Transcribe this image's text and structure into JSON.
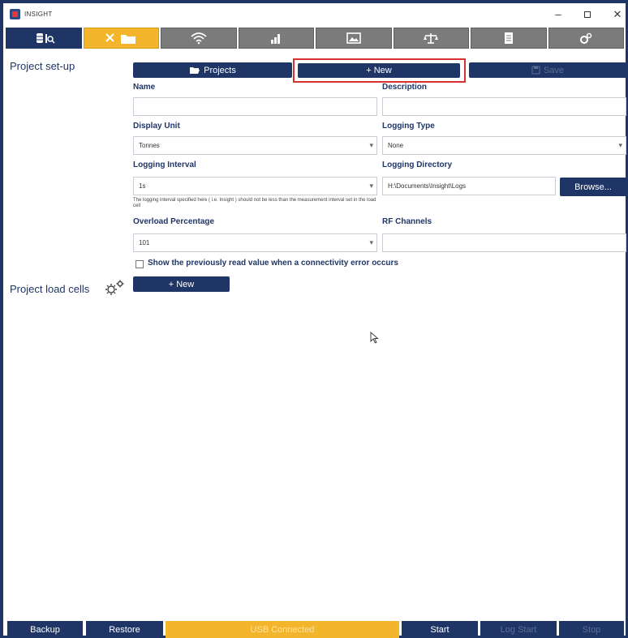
{
  "window": {
    "title": "INSIGHT",
    "minimize": "–",
    "close": "✕"
  },
  "tabs": [
    {
      "icon": "database-search-icon"
    },
    {
      "icon": "tools-folder-icon",
      "active": true
    },
    {
      "icon": "wifi-icon"
    },
    {
      "icon": "chart-icon"
    },
    {
      "icon": "image-icon"
    },
    {
      "icon": "scale-icon"
    },
    {
      "icon": "document-icon"
    },
    {
      "icon": "settings-cog-icon"
    }
  ],
  "project_setup": {
    "label": "Project set-up",
    "projects_button": "Projects",
    "new_button": "+ New",
    "save_button": "Save",
    "name_label": "Name",
    "name_value": "",
    "description_label": "Description",
    "description_value": "",
    "display_unit_label": "Display Unit",
    "display_unit_value": "Tonnes",
    "logging_type_label": "Logging Type",
    "logging_type_value": "None",
    "logging_interval_label": "Logging Interval",
    "logging_interval_value": "1s",
    "logging_interval_note": "The logging interval specified here ( i.e. Insight ) should not be less than the measurement interval set in the load cell",
    "logging_directory_label": "Logging Directory",
    "logging_directory_value": "H:\\Documents\\Insight\\Logs",
    "browse_button": "Browse...",
    "overload_label": "Overload Percentage",
    "overload_value": "101",
    "rf_channels_label": "RF Channels",
    "rf_channels_value": "",
    "show_previous_label": "Show the previously read value when a connectivity error occurs"
  },
  "load_cells": {
    "label": "Project load cells",
    "new_button": "+ New"
  },
  "bottom": {
    "backup": "Backup",
    "restore": "Restore",
    "status": "USB Connected",
    "start": "Start",
    "log_start": "Log Start",
    "stop": "Stop"
  },
  "colors": {
    "navy": "#1f3566",
    "accent": "#f3b52c",
    "tab_gray": "#7b7b7b",
    "highlight": "#d93030"
  }
}
